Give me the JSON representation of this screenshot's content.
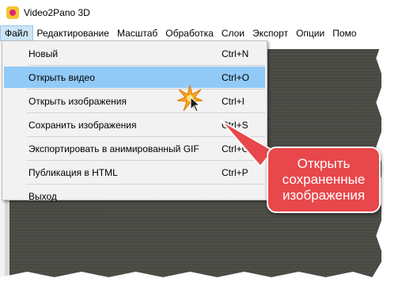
{
  "window": {
    "title": "Video2Pano 3D"
  },
  "menubar": {
    "items": [
      "Файл",
      "Редактирование",
      "Масштаб",
      "Обработка",
      "Слои",
      "Экспорт",
      "Опции",
      "Помо"
    ]
  },
  "file_menu": {
    "items": [
      {
        "label": "Новый",
        "shortcut": "Ctrl+N"
      },
      {
        "label": "Открыть видео",
        "shortcut": "Ctrl+O"
      },
      {
        "label": "Открыть изображения",
        "shortcut": "Ctrl+I"
      },
      {
        "label": "Сохранить изображения",
        "shortcut": "Ctrl+S"
      },
      {
        "label": "Экспортировать в анимированный GIF",
        "shortcut": "Ctrl+G"
      },
      {
        "label": "Публикация в HTML",
        "shortcut": "Ctrl+P"
      },
      {
        "label": "Выход",
        "shortcut": ""
      }
    ]
  },
  "callout": {
    "text": "Открыть сохраненные изображения"
  },
  "colors": {
    "callout": "#e8474b",
    "selected": "#91c9f7",
    "menu_active": "#cce4f7"
  },
  "icons": {
    "app": "video-camera-icon",
    "cursor": "arrow-cursor-icon",
    "click": "click-burst-icon"
  }
}
